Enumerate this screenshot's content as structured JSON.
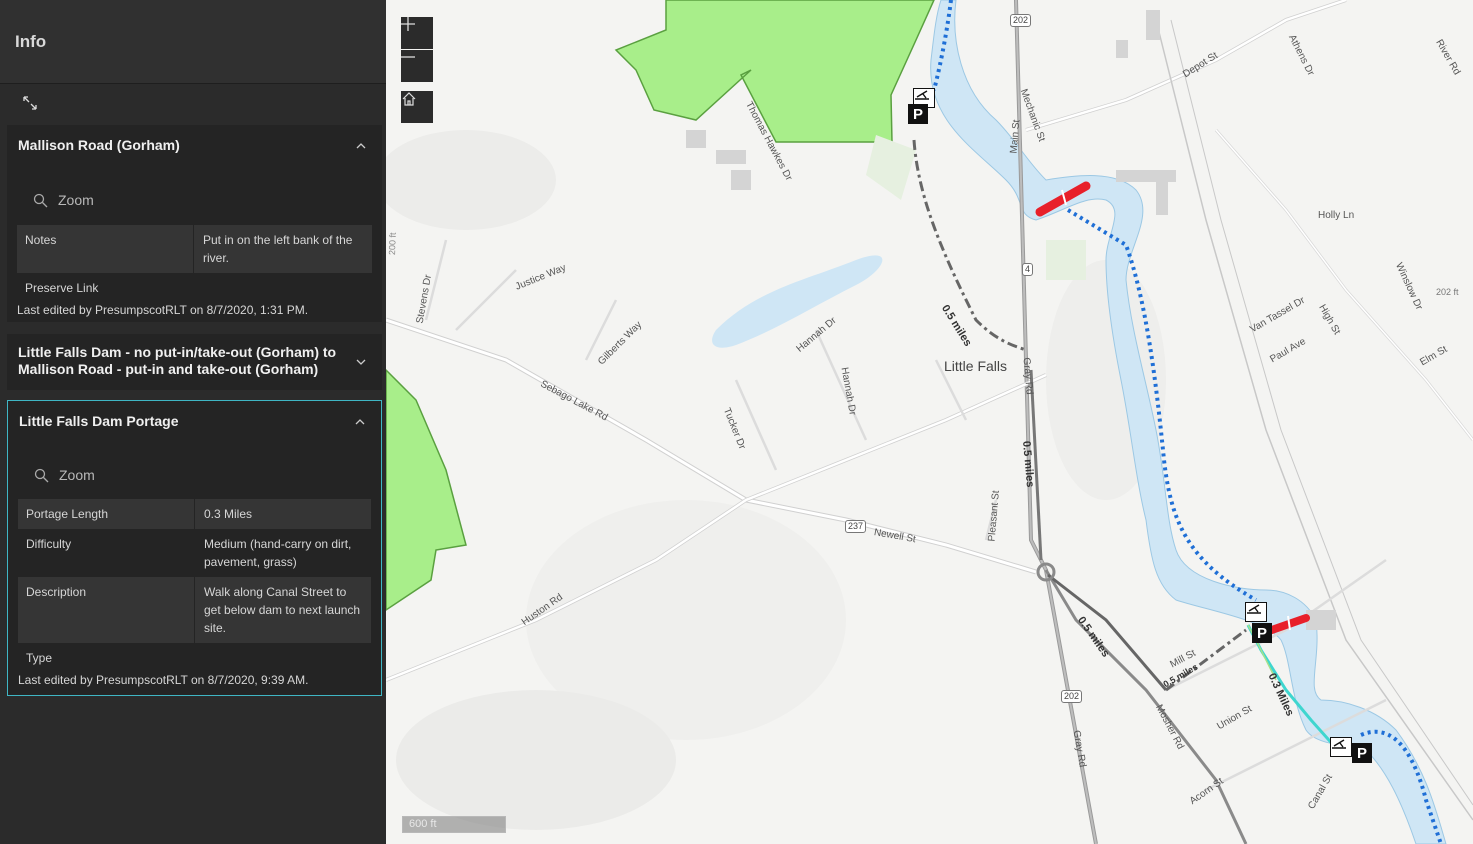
{
  "panel": {
    "title": "Info",
    "cards": [
      {
        "title": "Mallison Road (Gorham)",
        "zoom_label": "Zoom",
        "attributes": [
          {
            "key": "Notes",
            "value": "Put in on the left bank of the river."
          },
          {
            "key": "Preserve Link",
            "value": ""
          }
        ],
        "last_edited": "Last edited by PresumpscotRLT on 8/7/2020, 1:31 PM."
      },
      {
        "title": "Little Falls Dam - no put-in/take-out (Gorham) to Mallison Road - put-in and take-out (Gorham)"
      },
      {
        "title": "Little Falls Dam Portage",
        "zoom_label": "Zoom",
        "attributes": [
          {
            "key": "Portage Length",
            "value": "0.3 Miles"
          },
          {
            "key": "Difficulty",
            "value": "Medium (hand-carry on dirt, pavement, grass)"
          },
          {
            "key": "Description",
            "value": "Walk along Canal Street to get below dam to next launch site."
          },
          {
            "key": "Type",
            "value": ""
          }
        ],
        "last_edited": "Last edited by PresumpscotRLT on 8/7/2020, 9:39 AM."
      }
    ]
  },
  "map": {
    "scalebar": "600 ft",
    "town": "Little Falls",
    "highways": [
      "202",
      "4",
      "237",
      "202"
    ],
    "distances": [
      "0.5 miles",
      "0.5 miles",
      "0.5 miles",
      "0.5 miles",
      "0.3 Miles"
    ],
    "contours": [
      "200 ft",
      "202 ft"
    ],
    "streets": [
      "Thomas Hawkes Dr",
      "Mechanic St",
      "Main St",
      "Depot St",
      "Athens Dr",
      "River Rd",
      "Holly Ln",
      "Justice Way",
      "Stevens Dr",
      "Gilberts Way",
      "Hannah Dr",
      "Hannah Dr",
      "Sebago Lake Rd",
      "Tucker Dr",
      "Gray Rd",
      "Van Tassel Dr",
      "High St",
      "Winslow Dr",
      "Paul Ave",
      "Elm St",
      "Pleasant St",
      "Newell St",
      "Huston Rd",
      "Mosher Rd",
      "Union St",
      "Gray Rd",
      "Acorn St",
      "Canal St",
      "Mill St"
    ],
    "colors": {
      "river": "#cfe6f5",
      "trail": "#1f6fd6",
      "portage": "#3fd6cf",
      "dam": "#e8202a",
      "park": "#a8ee8a"
    }
  }
}
